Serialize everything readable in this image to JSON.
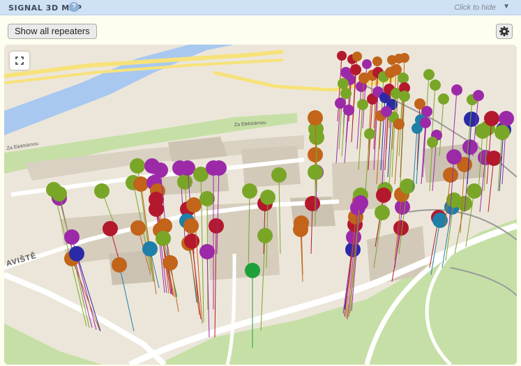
{
  "header": {
    "title": "SIGNAL 3D MAP",
    "help_glyph": "?",
    "hide_label": "Click to hide",
    "hide_arrow": "▼"
  },
  "toolbar": {
    "show_all_label": "Show all repeaters",
    "settings_icon": "gear-icon"
  },
  "map": {
    "fullscreen_icon": "fullscreen-icon",
    "labels": [
      "AVIŠTĚ",
      "Za Elektrárnou",
      "Za Elektrárnou"
    ],
    "colors": {
      "green_marker": "#7aa628",
      "purple_marker": "#9c2aa8",
      "orange_marker": "#c2641a",
      "red_marker": "#b3182d",
      "blue_marker": "#2a2aa8",
      "teal_marker": "#1f7fa8",
      "bright_green_marker": "#1ea03a",
      "river": "#a8c8f0",
      "park": "#c6dfa6",
      "road_yellow": "#f7e27a",
      "building": "#d9d1c2"
    }
  }
}
